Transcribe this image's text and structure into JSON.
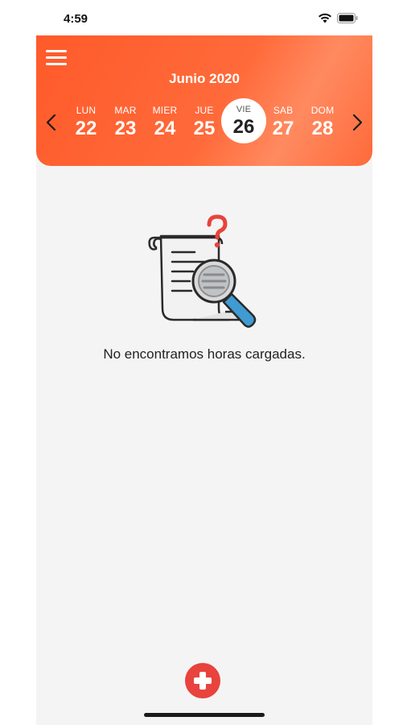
{
  "status_bar": {
    "time": "4:59"
  },
  "header": {
    "month_title": "Junio 2020",
    "days": [
      {
        "name": "LUN",
        "number": "22"
      },
      {
        "name": "MAR",
        "number": "23"
      },
      {
        "name": "MIER",
        "number": "24"
      },
      {
        "name": "JUE",
        "number": "25"
      },
      {
        "name": "VIE",
        "number": "26",
        "selected": true
      },
      {
        "name": "SAB",
        "number": "27"
      },
      {
        "name": "DOM",
        "number": "28"
      }
    ]
  },
  "empty_state": {
    "message": "No encontramos horas cargadas.",
    "icon": "document-search-question-icon"
  },
  "fab": {
    "icon": "plus-icon"
  },
  "colors": {
    "header_gradient_start": "#ff5a2a",
    "header_gradient_end": "#ff8a60",
    "fab": "#e8433c",
    "background": "#f4f4f4"
  }
}
